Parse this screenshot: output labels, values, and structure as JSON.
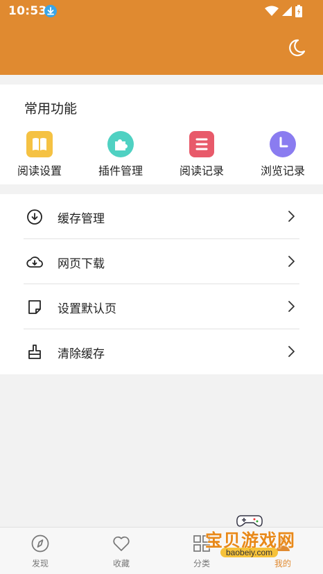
{
  "status_bar": {
    "time": "10:53"
  },
  "common_functions": {
    "title": "常用功能",
    "items": [
      {
        "label": "阅读设置",
        "icon": "book-icon",
        "color": "#f5c243"
      },
      {
        "label": "插件管理",
        "icon": "plugin-icon",
        "color": "#4fd1c2"
      },
      {
        "label": "阅读记录",
        "icon": "reading-record-icon",
        "color": "#e85a6a"
      },
      {
        "label": "浏览记录",
        "icon": "clock-icon",
        "color": "#8a7cf0"
      }
    ]
  },
  "menu": {
    "items": [
      {
        "label": "缓存管理",
        "icon": "download-circle-icon"
      },
      {
        "label": "网页下载",
        "icon": "cloud-download-icon"
      },
      {
        "label": "设置默认页",
        "icon": "note-icon"
      },
      {
        "label": "清除缓存",
        "icon": "brush-icon"
      }
    ]
  },
  "bottom_nav": {
    "items": [
      {
        "label": "发现",
        "icon": "compass-icon"
      },
      {
        "label": "收藏",
        "icon": "heart-icon"
      },
      {
        "label": "分类",
        "icon": "grid-icon"
      },
      {
        "label": "我的",
        "icon": "profile-icon",
        "active": true
      }
    ]
  },
  "watermark": {
    "title": "宝贝游戏网",
    "url": "baobeiy.com"
  },
  "colors": {
    "accent": "#e08a30"
  }
}
